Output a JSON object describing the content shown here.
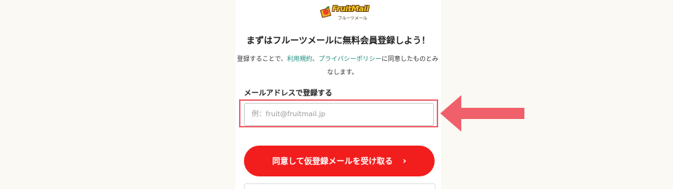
{
  "brand": {
    "logo_text": "FruitMail",
    "logo_subtext": "フルーツメール"
  },
  "headline": "まずはフルーツメールに無料会員登録しよう！",
  "consent": {
    "prefix": "登録することで、",
    "terms_link": "利用規約",
    "separator": "、",
    "privacy_link": "プライバシーポリシー",
    "suffix_line1": "に同意したものとみ",
    "line2": "なします。"
  },
  "email_form": {
    "label": "メールアドレスで登録する",
    "placeholder": "例：fruit@fruitmail.jp",
    "value": ""
  },
  "submit_button": {
    "label": "同意して仮登録メールを受け取る",
    "chevron": "›"
  },
  "colors": {
    "page_background": "#fbf9f3",
    "button": "#f21d1d",
    "link": "#1e8c7e",
    "annotation": "#f0606a"
  },
  "annotation": {
    "type": "highlight-box-with-arrow",
    "target": "email-input",
    "arrow_icon": "left-arrow-icon"
  }
}
